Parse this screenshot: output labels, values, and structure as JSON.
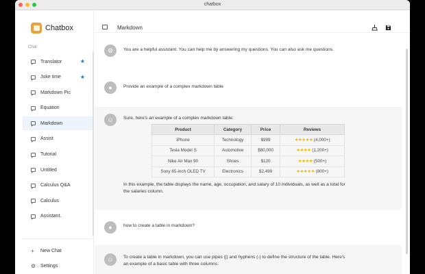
{
  "window": {
    "title": "chatbox"
  },
  "sidebar": {
    "brand": "Chatbox",
    "section_label": "Chat",
    "items": [
      {
        "label": "Translator",
        "starred": true
      },
      {
        "label": "Joke time",
        "starred": true
      },
      {
        "label": "Markdown Pic",
        "starred": false
      },
      {
        "label": "Equation",
        "starred": false
      },
      {
        "label": "Markdown",
        "starred": false,
        "active": true
      },
      {
        "label": "Assist",
        "starred": false
      },
      {
        "label": "Tutorial",
        "starred": false
      },
      {
        "label": "Untitled",
        "starred": false
      },
      {
        "label": "Calculus Q&A",
        "starred": false
      },
      {
        "label": "Calculus",
        "starred": false
      },
      {
        "label": "Assistant.",
        "starred": false
      }
    ],
    "new_chat": "New Chat",
    "settings": "Settings",
    "star_glyph": "★"
  },
  "header": {
    "title": "Markdown"
  },
  "messages": {
    "system": "You are a helpful assistant. You can help me by answering my questions. You can also ask me questions.",
    "user1": "Provide an example of a complex markdown table",
    "assistant1_intro": "Sure, here's an example of a complex markdown table:",
    "assistant1_outro_line1": "In this example, the table displays the name, age, occupation, and salary of 10 individuals, as well as a total for",
    "assistant1_outro_line2": "the salaries column.",
    "user2": "how to create a table in markdown?",
    "assistant2_line1": "To create a table in markdown, you can use pipes (|) and hyphens (-) to define the structure of the table. Here's",
    "assistant2_line2": "an example of a basic table with three columns:"
  },
  "table": {
    "headers": [
      "Product",
      "Category",
      "Price",
      "Reviews"
    ],
    "rows": [
      {
        "product": "iPhone",
        "category": "Technology",
        "price": "$999",
        "stars": "★★★★★",
        "count": "(4,000+)"
      },
      {
        "product": "Tesla Model S",
        "category": "Automotive",
        "price": "$80,000",
        "stars": "★★★★",
        "count": "(1,200+)"
      },
      {
        "product": "Nike Air Max 90",
        "category": "Shoes",
        "price": "$120",
        "stars": "★★★★",
        "count": "(500+)"
      },
      {
        "product": "Sony 65-inch OLED TV",
        "category": "Electronics",
        "price": "$2,499",
        "stars": "★★★★★",
        "count": "(800+)"
      }
    ]
  },
  "icons": {
    "system": "gear-icon",
    "user": "person-icon",
    "assistant": "bot-icon",
    "clean": "broom-icon",
    "save": "save-icon",
    "new_chat": "plus-icon",
    "settings": "gear-icon"
  },
  "colors": {
    "accent": "#1976d2",
    "star": "#f5b800",
    "brand": "#e8a13c",
    "active_bg": "#eef4fb"
  }
}
